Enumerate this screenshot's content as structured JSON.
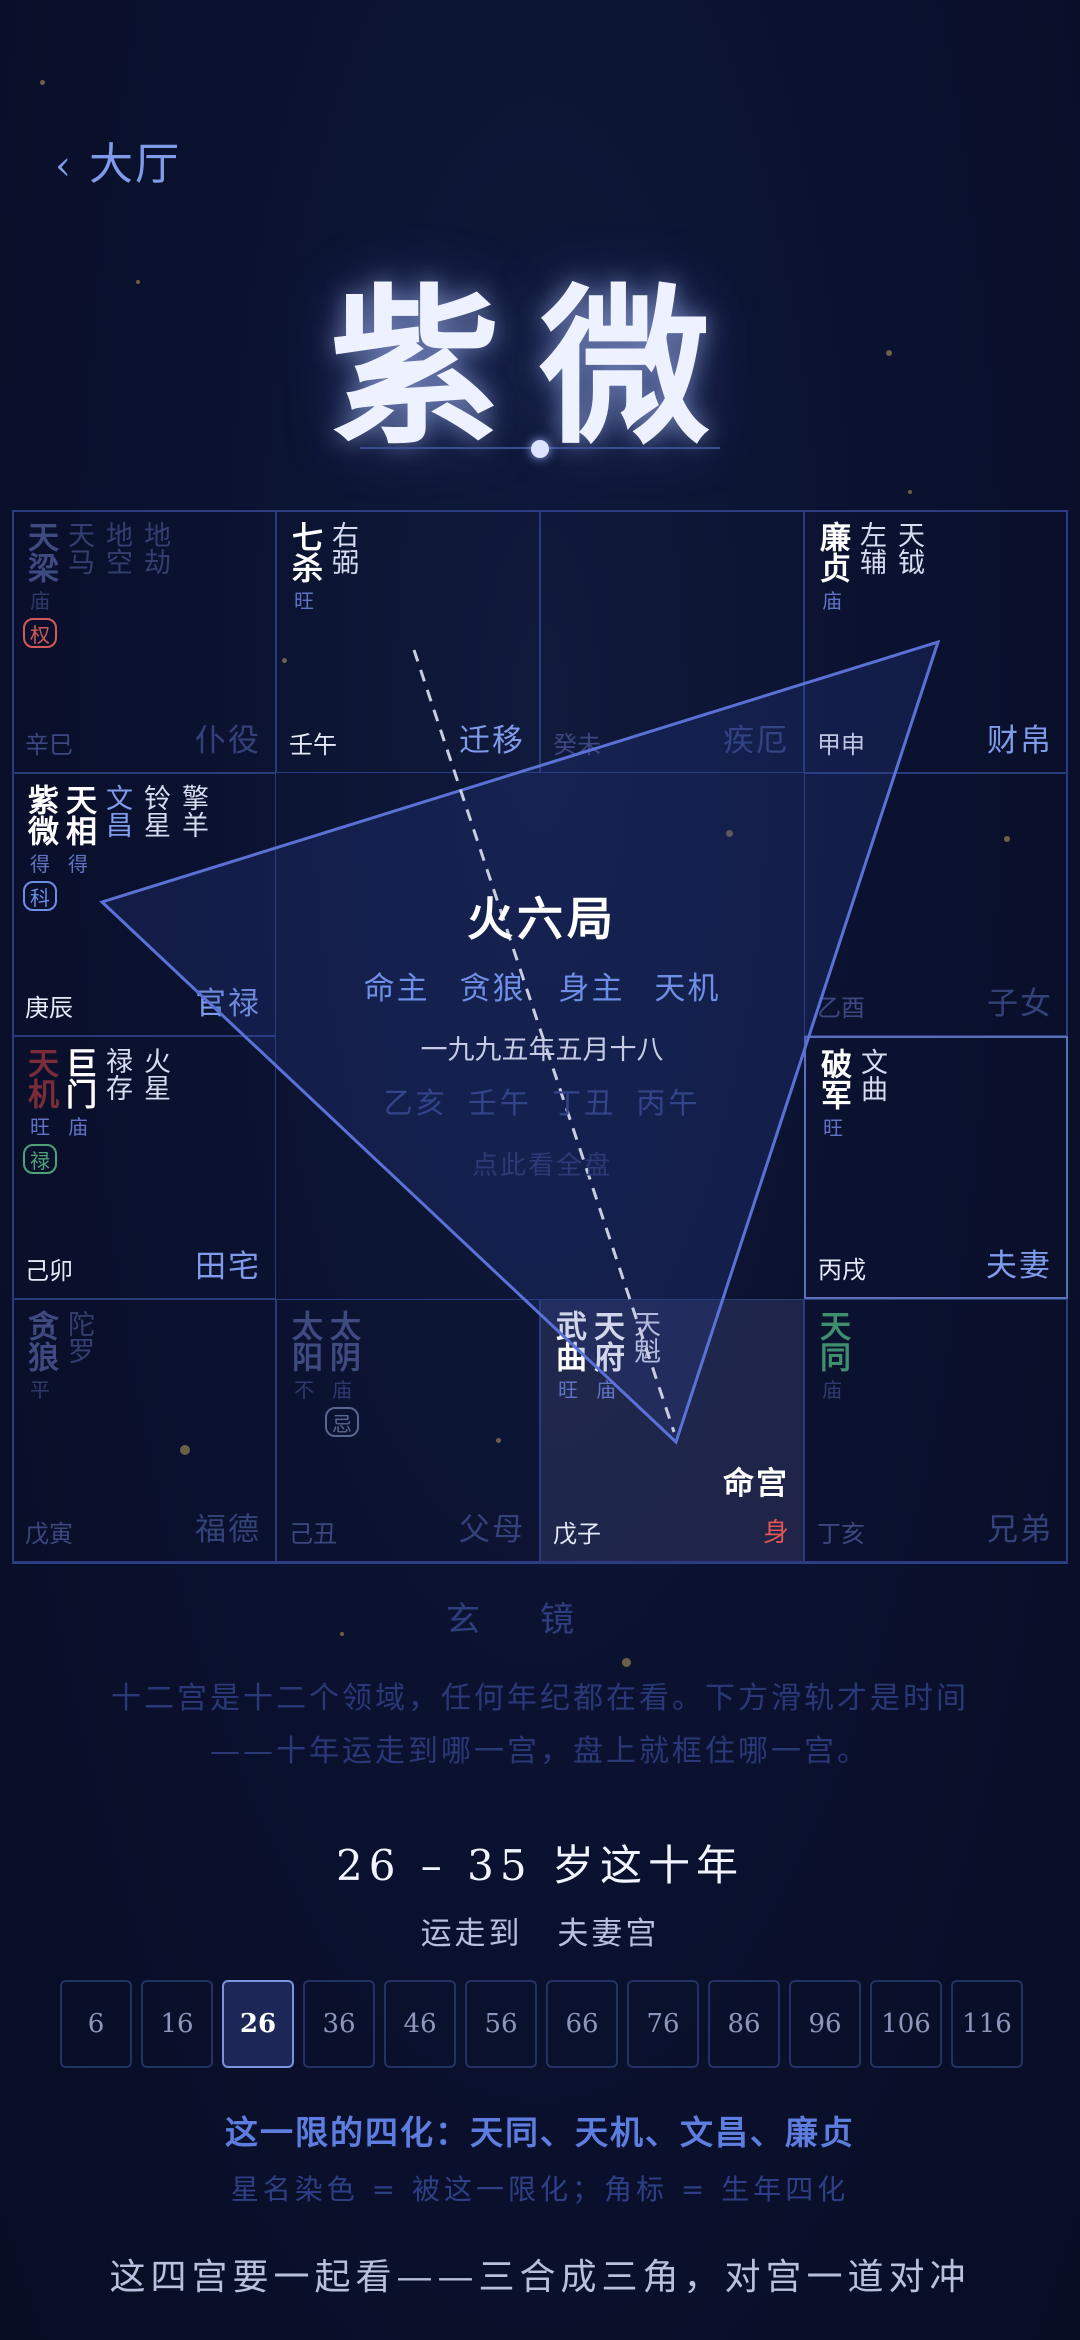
{
  "nav": {
    "back_label": "大厅"
  },
  "title": "紫微",
  "center": {
    "ju": "火六局",
    "masters": "命主 贪狼　身主 天机",
    "date": "一九九五年五月十八",
    "pillars": "乙亥 壬午 丁丑 丙午",
    "full_chart_link": "点此看全盘"
  },
  "palaces": [
    {
      "ganzhi": "辛巳",
      "name": "仆役",
      "stars": [
        {
          "n": "天梁",
          "b": "庙",
          "hua": "权",
          "hua_color": "#d05a5a"
        },
        {
          "n": "天马",
          "minor": true
        },
        {
          "n": "地空",
          "minor": true
        },
        {
          "n": "地劫",
          "minor": true
        }
      ]
    },
    {
      "ganzhi": "壬午",
      "name": "迁移",
      "stars": [
        {
          "n": "七杀",
          "b": "旺"
        },
        {
          "n": "右弼",
          "minor": true
        }
      ]
    },
    {
      "ganzhi": "癸未",
      "name": "疾厄",
      "stars": []
    },
    {
      "ganzhi": "甲申",
      "name": "财帛",
      "stars": [
        {
          "n": "廉贞",
          "b": "庙"
        },
        {
          "n": "左辅",
          "minor": true
        },
        {
          "n": "天钺",
          "minor": true
        }
      ]
    },
    {
      "ganzhi": "庚辰",
      "name": "官禄",
      "stars": [
        {
          "n": "紫微",
          "b": "得",
          "hua": "科",
          "hua_color": "#6c8fe6"
        },
        {
          "n": "天相",
          "b": "得"
        },
        {
          "n": "文昌",
          "minor": true,
          "color": "#7f9bea"
        },
        {
          "n": "铃星",
          "minor": true
        },
        {
          "n": "擎羊",
          "minor": true
        }
      ]
    },
    {
      "ganzhi": "乙酉",
      "name": "子女",
      "stars": []
    },
    {
      "ganzhi": "己卯",
      "name": "田宅",
      "stars": [
        {
          "n": "天机",
          "b": "旺",
          "hua": "禄",
          "hua_color": "#4fa178",
          "color": "#7a2d38"
        },
        {
          "n": "巨门",
          "b": "庙"
        },
        {
          "n": "禄存",
          "minor": true
        },
        {
          "n": "火星",
          "minor": true
        }
      ]
    },
    {
      "ganzhi": "丙戌",
      "name": "夫妻",
      "stars": [
        {
          "n": "破军",
          "b": "旺"
        },
        {
          "n": "文曲",
          "minor": true
        }
      ]
    },
    {
      "ganzhi": "戊寅",
      "name": "福德",
      "stars": [
        {
          "n": "贪狼",
          "b": "平"
        },
        {
          "n": "陀罗",
          "minor": true
        }
      ]
    },
    {
      "ganzhi": "己丑",
      "name": "父母",
      "stars": [
        {
          "n": "太阳",
          "b": "不"
        },
        {
          "n": "太阴",
          "b": "庙",
          "hua": "忌",
          "hua_color": "#5a6690"
        }
      ]
    },
    {
      "ganzhi": "戊子",
      "name": "命宫",
      "shen": "身",
      "stars": [
        {
          "n": "武曲",
          "b": "旺"
        },
        {
          "n": "天府",
          "b": "庙"
        },
        {
          "n": "天魁",
          "minor": true
        }
      ]
    },
    {
      "ganzhi": "丁亥",
      "name": "兄弟",
      "stars": [
        {
          "n": "天同",
          "b": "庙",
          "color": "#3f8f6e"
        }
      ]
    }
  ],
  "mirror": {
    "title": "玄镜",
    "text1": "十二宫是十二个领域，任何年纪都在看。下方滑轨才是时间",
    "text2": "——十年运走到哪一宫，盘上就框住哪一宫。"
  },
  "decade": {
    "range": "26 – 35 岁这十年",
    "arrive": "运走到 夫妻宫",
    "ages": [
      "6",
      "16",
      "26",
      "36",
      "46",
      "56",
      "66",
      "76",
      "86",
      "96",
      "106",
      "116"
    ],
    "active_index": 2
  },
  "sihua": "这一限的四化：天同、天机、文昌、廉贞",
  "legend": "星名染色 = 被这一限化；角标 = 生年四化",
  "bottom": "这四宫要一起看——三合成三角，对宫一道对冲",
  "colors": {
    "accent": "#7f9bea",
    "shen": "#e25555",
    "line": "#5a72d6"
  }
}
